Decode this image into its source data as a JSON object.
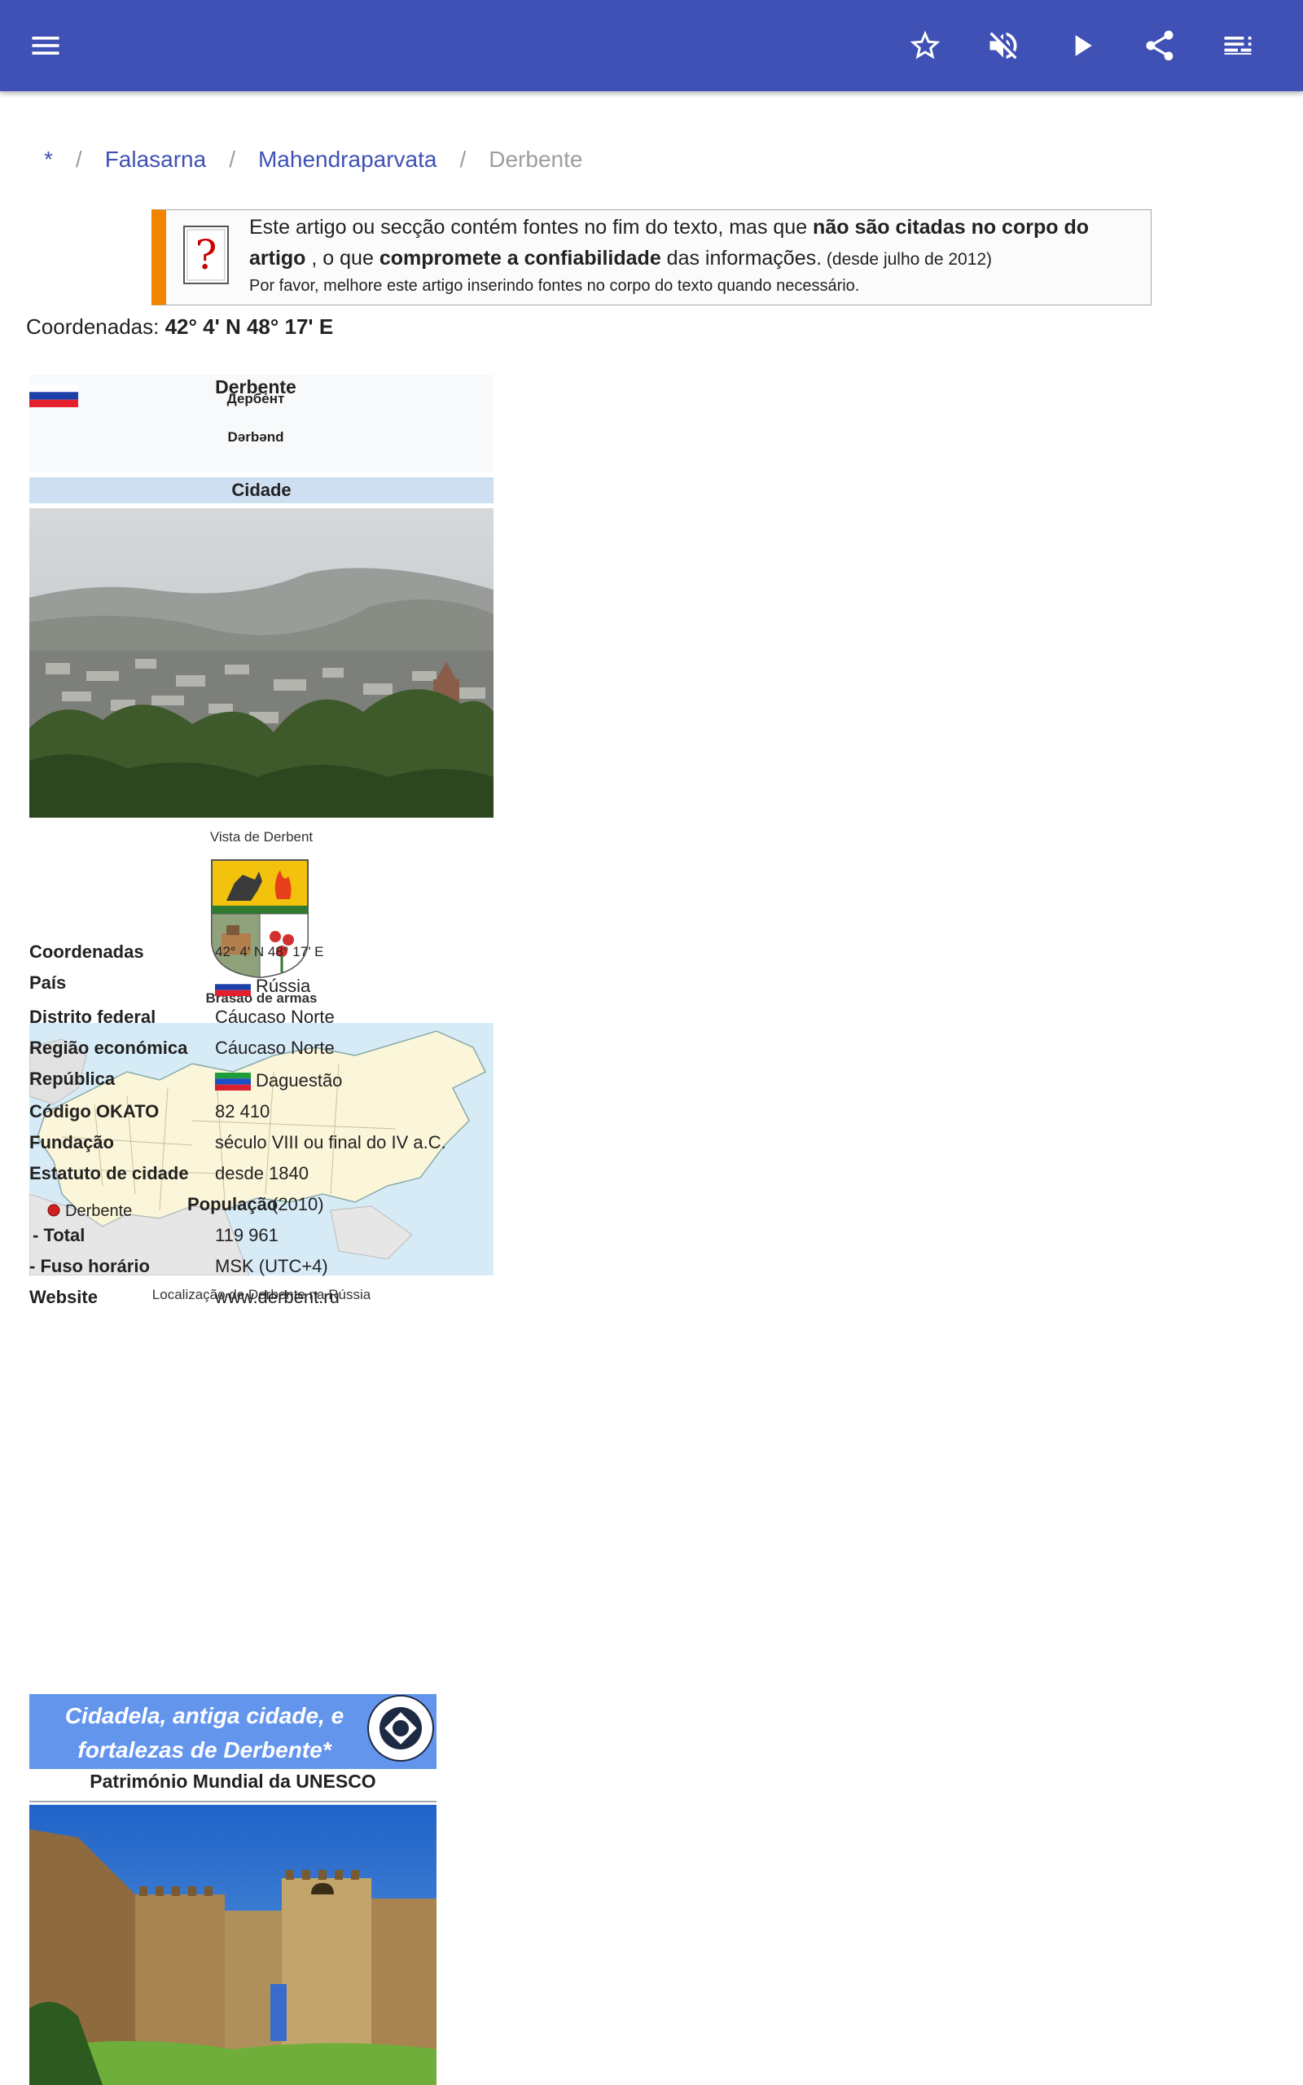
{
  "colors": {
    "appbar": "#3f51b5",
    "link": "#3f51b5",
    "ambox_accent": "#f28500",
    "infobox_type_bg": "#cedff2",
    "unesco_bg": "#6495ed"
  },
  "appbar": {
    "menu_icon": "menu-icon",
    "actions": [
      "star-outline-icon",
      "volume-off-icon",
      "play-icon",
      "share-icon",
      "playlist-icon"
    ]
  },
  "breadcrumb": {
    "items": [
      "*",
      "Falasarna",
      "Mahendraparvata"
    ],
    "current": "Derbente",
    "separator": "/"
  },
  "ambox": {
    "t1": "Este artigo ou secção contém fontes no fim do texto, mas que ",
    "b1": "não são citadas no corpo do artigo",
    "t2": " , o que ",
    "b2": "compromete a confiabilidade",
    "t3": " das informações.",
    "date": " (desde julho de 2012)",
    "line3": "Por favor, melhore este artigo inserindo fontes no corpo do texto quando necessário."
  },
  "coords_top": {
    "label": "Coordenadas: ",
    "value": "42° 4' N 48° 17' E"
  },
  "infobox": {
    "name": "Derbente",
    "name_ru": "Дербе́нт",
    "name_az": "Dərbənd",
    "type": "Cidade",
    "photo_caption": "Vista de Derbent",
    "coa_caption": "Brasão de armas",
    "map_label": "Derbente",
    "map_caption": "Localização de Derbente na Rússia",
    "rows": [
      {
        "k": "Coordenadas",
        "v": "42° 4' N 48° 17' E"
      },
      {
        "k": "País",
        "v": "Rússia"
      },
      {
        "k": "Distrito federal",
        "v": "Cáucaso Norte"
      },
      {
        "k": "Região económica",
        "v": "Cáucaso Norte"
      },
      {
        "k": "República",
        "v": "Daguestão"
      },
      {
        "k": "Código OKATO",
        "v": "82 410"
      },
      {
        "k": "Fundação",
        "v": "século VIII ou final do IV a.C."
      },
      {
        "k": "Estatuto de cidade",
        "v": "desde 1840"
      },
      {
        "k": "População",
        "v": " (2010)"
      },
      {
        "k": " - Total",
        "v": "119 961"
      },
      {
        "k": "- Fuso horário",
        "v": "MSK (UTC+4)"
      },
      {
        "k": "Website",
        "v": "www.derbent.ru"
      }
    ]
  },
  "unesco": {
    "title": "Cidadela, antiga cidade, e fortalezas de Derbente*",
    "subtitle": "Património Mundial da UNESCO",
    "logo_text": "WORLD HERITAGE · PATRIMOINE MONDIAL"
  }
}
